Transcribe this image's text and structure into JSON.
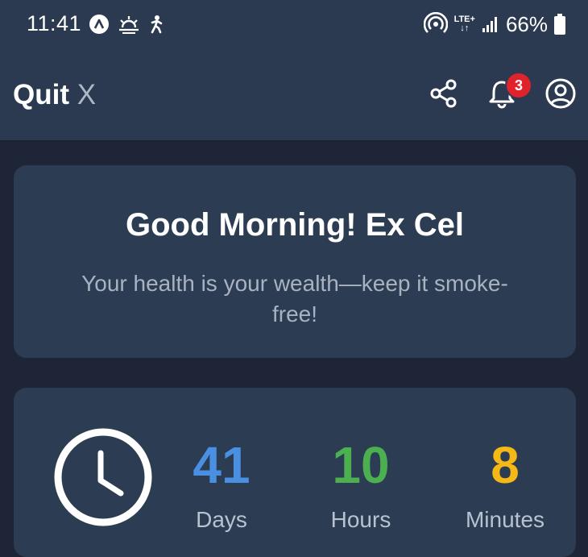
{
  "status_bar": {
    "time": "11:41",
    "network": "LTE+",
    "battery": "66%"
  },
  "app_bar": {
    "brand_primary": "Quit",
    "brand_secondary": "X",
    "notification_count": "3"
  },
  "greeting": {
    "title": "Good Morning! Ex Cel",
    "subtitle": "Your health is your wealth—keep it smoke-free!"
  },
  "timer": {
    "days_value": "41",
    "days_label": "Days",
    "hours_value": "10",
    "hours_label": "Hours",
    "minutes_value": "8",
    "minutes_label": "Minutes"
  },
  "colors": {
    "background": "#1d2536",
    "bar": "#2b3a50",
    "card": "#2c3c52",
    "days": "#4a90e2",
    "hours": "#4caf50",
    "minutes": "#f5b916",
    "badge": "#e0222b"
  },
  "icons": {
    "share": "share-icon",
    "notifications": "bell-icon",
    "profile": "account-circle-icon",
    "timer": "clock-icon"
  }
}
